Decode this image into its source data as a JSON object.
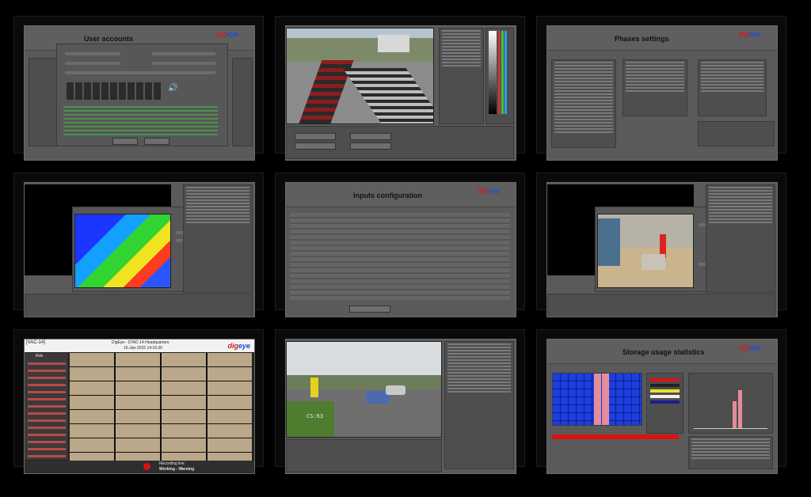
{
  "logo": {
    "part1": "dig",
    "part2": "eye"
  },
  "tiles": {
    "user_accounts": {
      "title": "User accounts"
    },
    "phases_settings": {
      "title": "Phases settings"
    },
    "inputs_configuration": {
      "title": "Inputs configuration"
    },
    "storage_usage_statistics": {
      "title": "Storage usage statistics"
    },
    "live_view": {
      "header_left": "[VAC-14]",
      "header_center": "DigEye - STAC-14 Headquarters",
      "header_date": "15-Jan-2015 14:16:20",
      "user": "Rob",
      "status_line1": "Recording live",
      "status_line2": "Working - Warning"
    },
    "road_camera": {
      "overlay_text": "CS:63"
    }
  },
  "colors": {
    "accent_red": "#c22",
    "accent_blue": "#1d4fd8",
    "panel": "#5a5a5a"
  }
}
